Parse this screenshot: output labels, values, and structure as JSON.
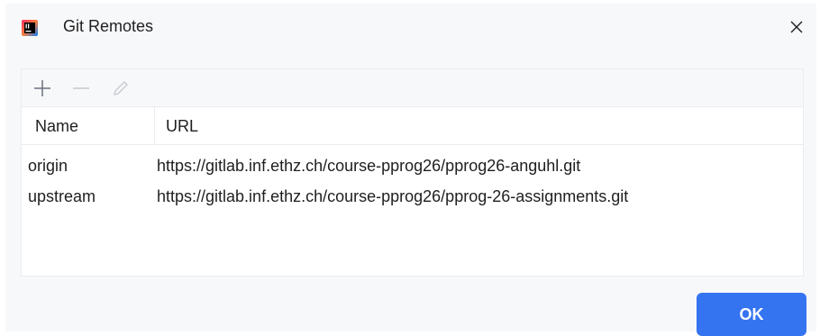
{
  "window": {
    "title": "Git Remotes",
    "app_icon": "intellij-idea-icon",
    "close_icon": "close-icon"
  },
  "toolbar": {
    "add_icon": "add-icon",
    "remove_icon": "remove-icon",
    "edit_icon": "edit-icon"
  },
  "table": {
    "columns": [
      "Name",
      "URL"
    ],
    "rows": [
      {
        "name": "origin",
        "url": "https://gitlab.inf.ethz.ch/course-pprog26/pprog26-anguhl.git"
      },
      {
        "name": "upstream",
        "url": "https://gitlab.inf.ethz.ch/course-pprog26/pprog-26-assignments.git"
      }
    ]
  },
  "footer": {
    "ok_label": "OK"
  },
  "colors": {
    "accent": "#3574f0",
    "background": "#f7f8fa",
    "border": "#ebecf0"
  }
}
